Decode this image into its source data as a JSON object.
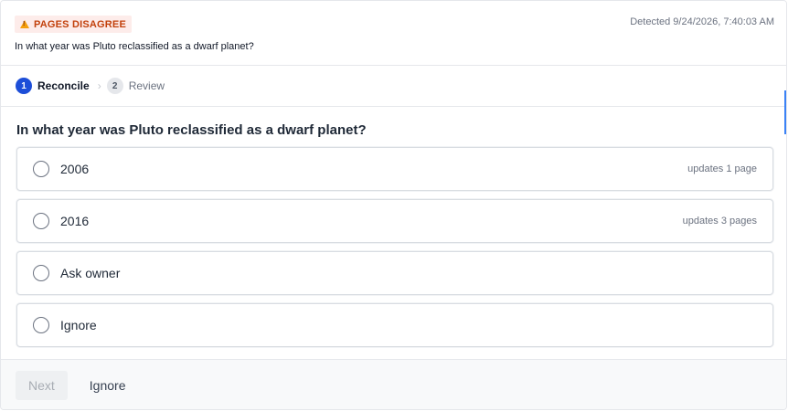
{
  "header": {
    "badge_label": "PAGES DISAGREE",
    "badge_icon": "warning-icon",
    "detected": "Detected 9/24/2026, 7:40:03 AM",
    "question": "In what year was Pluto reclassified as a dwarf planet?"
  },
  "stepper": {
    "steps": [
      {
        "number": "1",
        "label": "Reconcile",
        "state": "active"
      },
      {
        "number": "2",
        "label": "Review",
        "state": "inactive"
      }
    ],
    "separator": "›"
  },
  "main": {
    "question": "In what year was Pluto reclassified as a dwarf planet?",
    "options": [
      {
        "label": "2006",
        "meta": "updates 1 page"
      },
      {
        "label": "2016",
        "meta": "updates 3 pages"
      },
      {
        "label": "Ask owner",
        "meta": ""
      },
      {
        "label": "Ignore",
        "meta": ""
      }
    ]
  },
  "footer": {
    "next_label": "Next",
    "ignore_label": "Ignore"
  },
  "colors": {
    "accent": "#1d4ed8",
    "badge_bg": "#fdecea",
    "badge_text": "#c2410c",
    "warning": "#f59e0b"
  }
}
